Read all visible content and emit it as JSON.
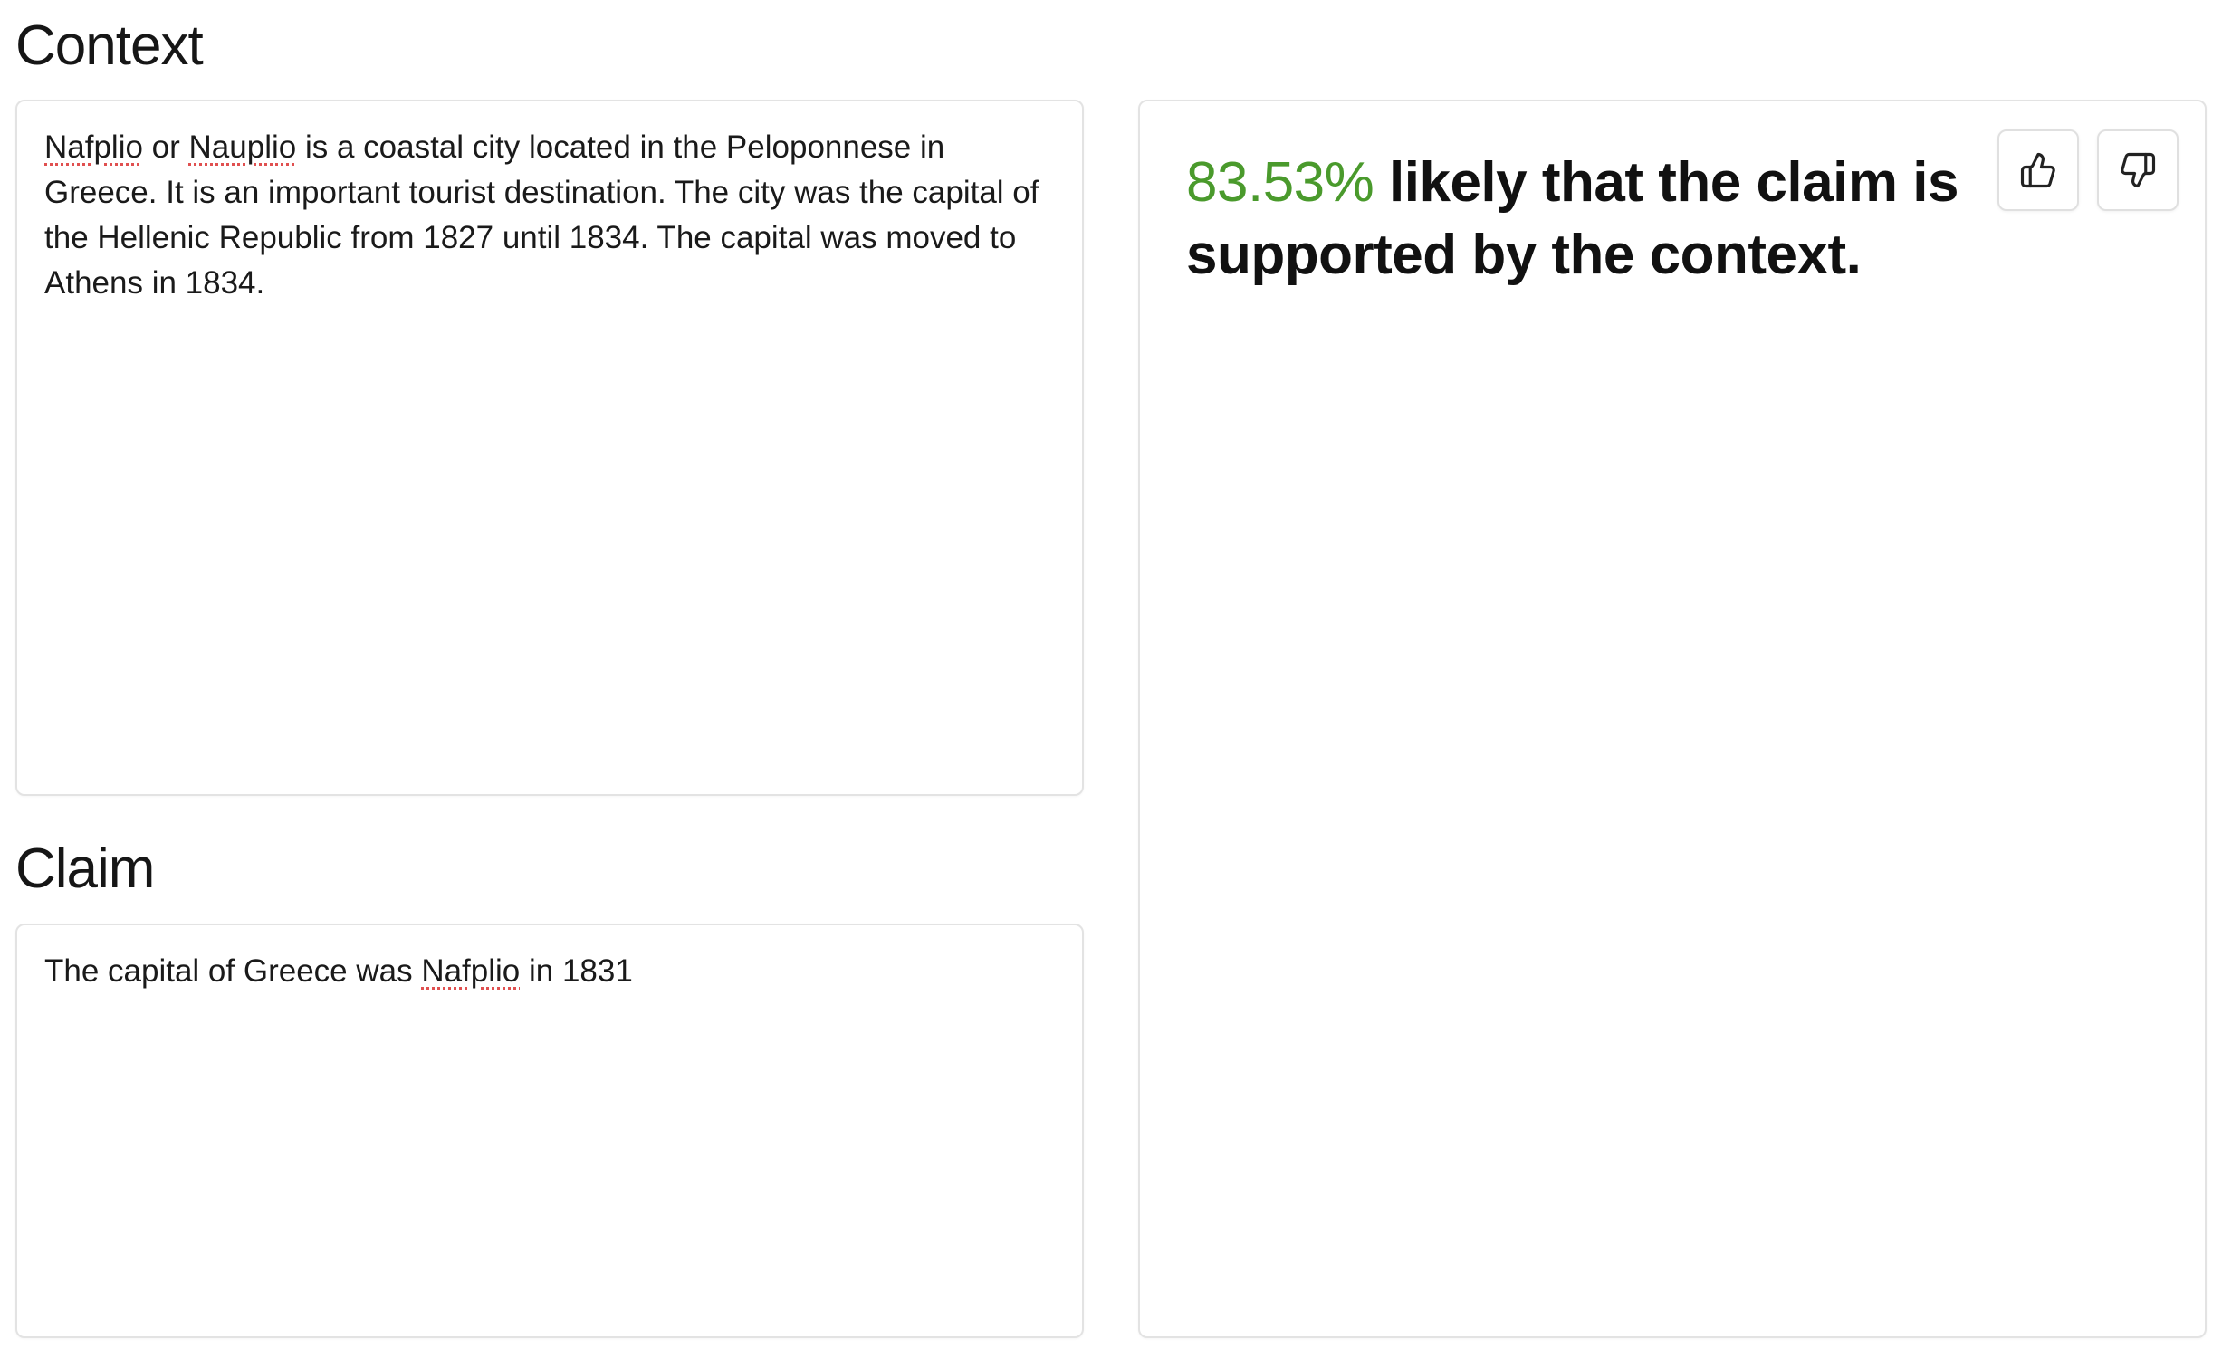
{
  "context": {
    "heading": "Context",
    "text_parts": {
      "w1": "Nafplio",
      "t1": " or ",
      "w2": "Nauplio",
      "t2": " is a coastal city located in the Peloponnese in Greece. It is an important tourist destination. The city was the capital of the Hellenic Republic from 1827 until 1834. The capital was moved to Athens in 1834."
    }
  },
  "claim": {
    "heading": "Claim",
    "text_parts": {
      "t1": "The capital of Greece was ",
      "w1": "Nafplio",
      "t2": " in 1831"
    }
  },
  "result": {
    "percentage": "83.53%",
    "message": " likely that the claim is supported by the context.",
    "percentage_color": "#4a9a2c"
  },
  "feedback": {
    "thumbs_up_icon": "thumbs-up-icon",
    "thumbs_down_icon": "thumbs-down-icon"
  },
  "colors": {
    "border": "#e3e3e3",
    "spellcheck_underline": "#e05050"
  }
}
